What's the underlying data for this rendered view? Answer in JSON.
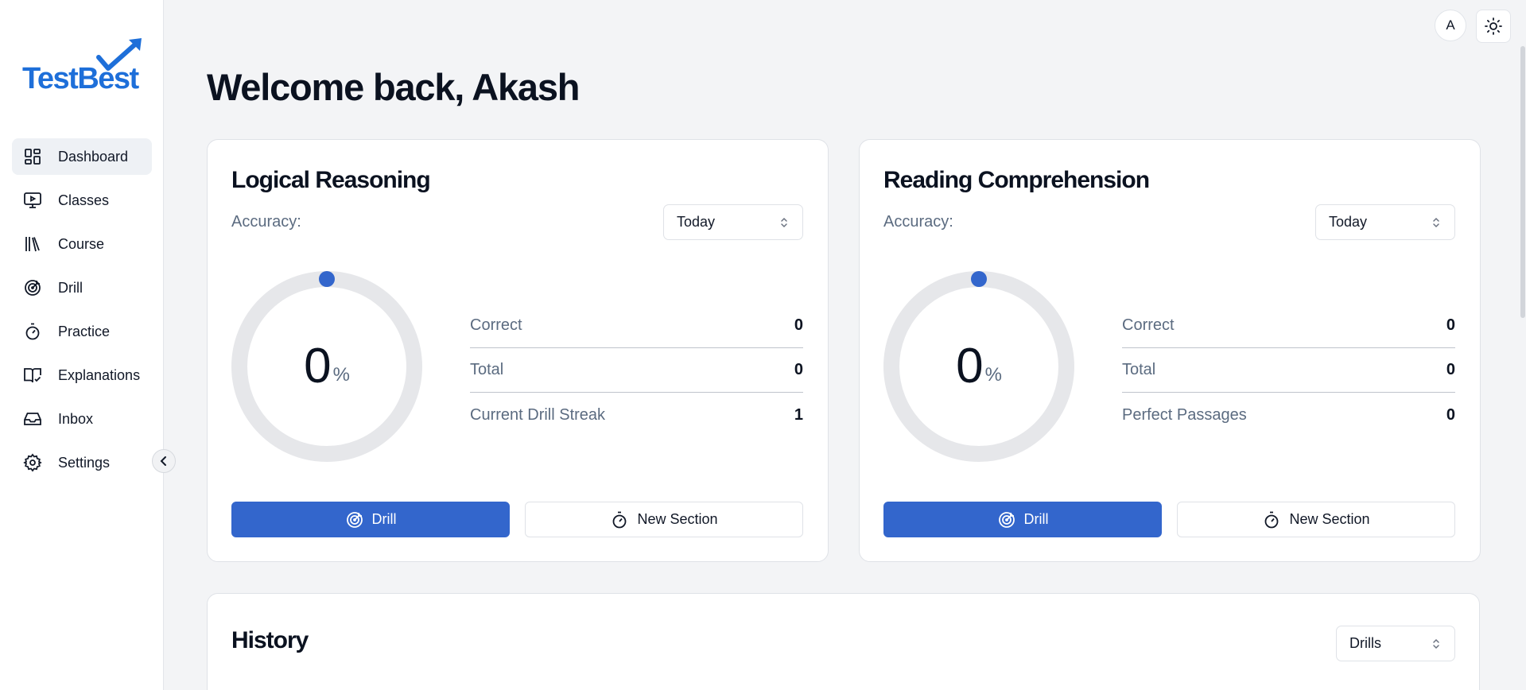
{
  "brand": {
    "name": "TestBest",
    "primary_color": "#1e6fd9",
    "accent_color": "#3366cc"
  },
  "topbar": {
    "avatar_initial": "A",
    "theme_icon": "sun-icon"
  },
  "sidebar": {
    "items": [
      {
        "label": "Dashboard",
        "icon": "dashboard-icon",
        "active": true
      },
      {
        "label": "Classes",
        "icon": "monitor-play-icon"
      },
      {
        "label": "Course",
        "icon": "library-books-icon"
      },
      {
        "label": "Drill",
        "icon": "target-icon"
      },
      {
        "label": "Practice",
        "icon": "stopwatch-icon"
      },
      {
        "label": "Explanations",
        "icon": "book-check-icon"
      },
      {
        "label": "Inbox",
        "icon": "inbox-icon"
      },
      {
        "label": "Settings",
        "icon": "gear-icon"
      }
    ],
    "collapse_icon": "chevron-left-icon"
  },
  "main": {
    "welcome": "Welcome back, Akash",
    "cards": [
      {
        "title": "Logical Reasoning",
        "accuracy_label": "Accuracy:",
        "period": "Today",
        "accuracy_value": "0",
        "accuracy_unit": "%",
        "accuracy_fraction": 0,
        "stats": [
          {
            "label": "Correct",
            "value": "0"
          },
          {
            "label": "Total",
            "value": "0"
          },
          {
            "label": "Current Drill Streak",
            "value": "1"
          }
        ],
        "drill_label": "Drill",
        "section_label": "New Section"
      },
      {
        "title": "Reading Comprehension",
        "accuracy_label": "Accuracy:",
        "period": "Today",
        "accuracy_value": "0",
        "accuracy_unit": "%",
        "accuracy_fraction": 0,
        "stats": [
          {
            "label": "Correct",
            "value": "0"
          },
          {
            "label": "Total",
            "value": "0"
          },
          {
            "label": "Perfect Passages",
            "value": "0"
          }
        ],
        "drill_label": "Drill",
        "section_label": "New Section"
      }
    ],
    "history": {
      "title": "History",
      "filter": "Drills"
    }
  }
}
